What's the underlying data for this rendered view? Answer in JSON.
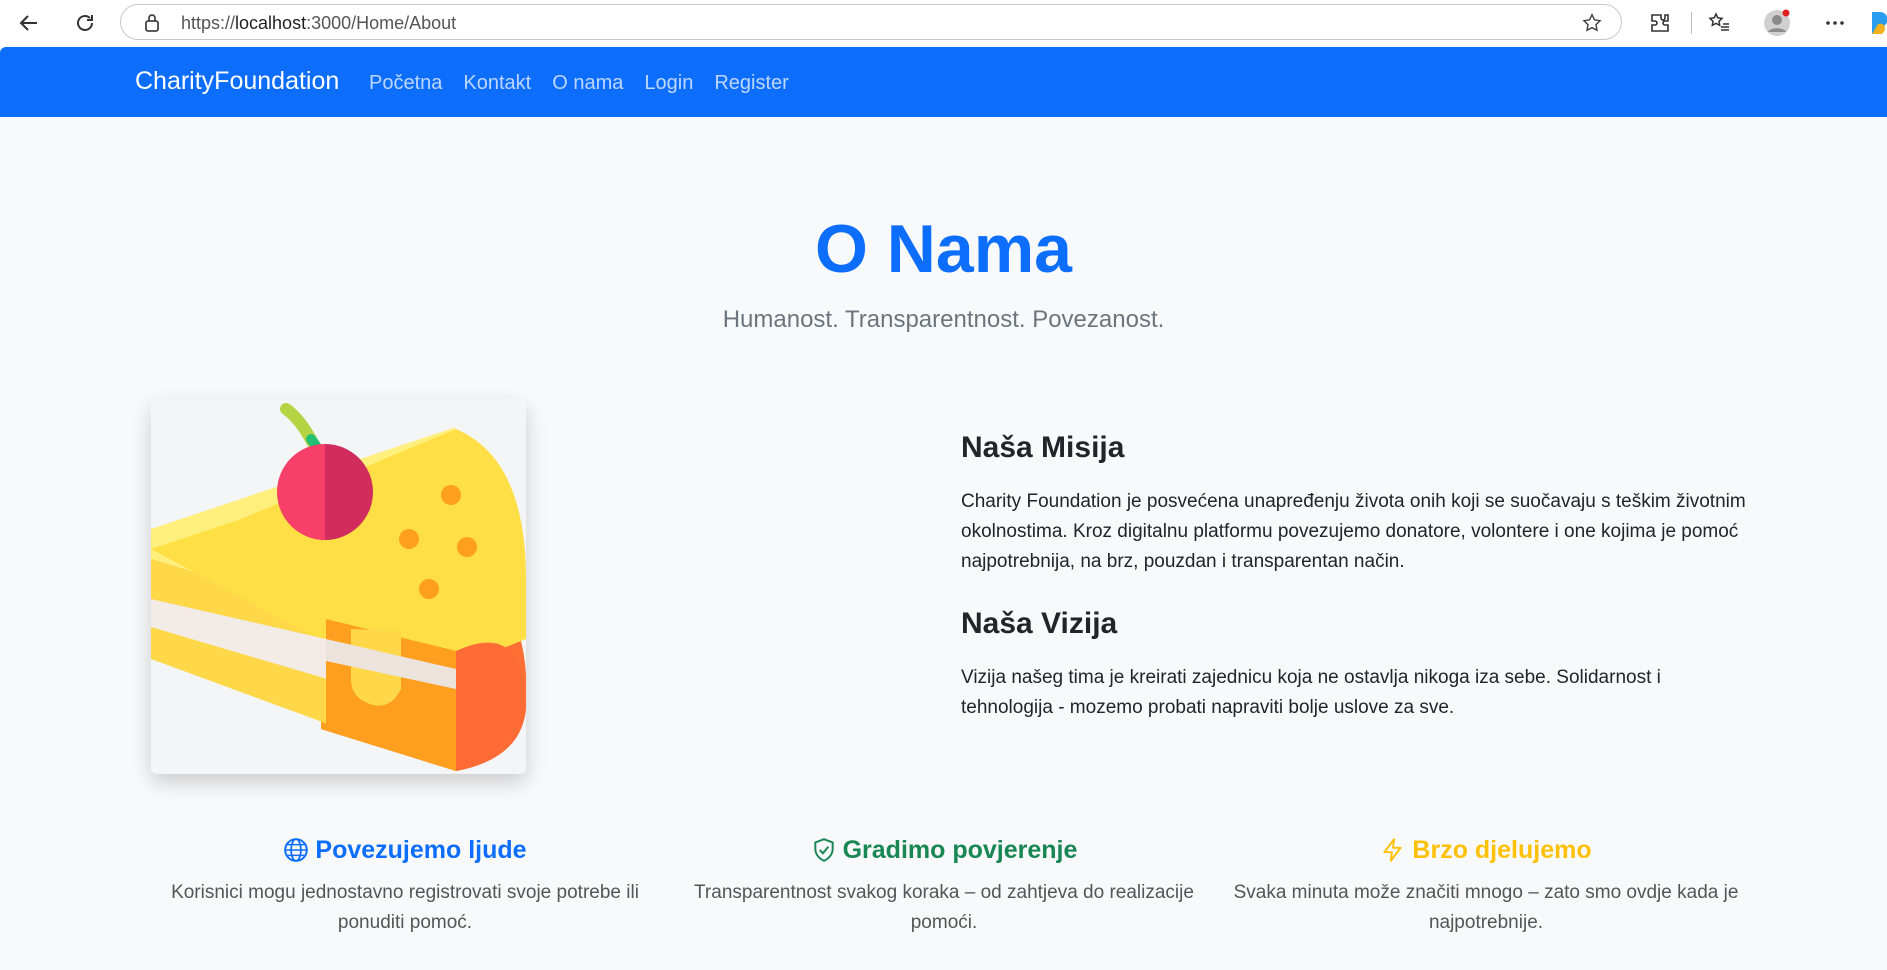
{
  "browser": {
    "url_prefix": "https://",
    "url_host": "localhost",
    "url_rest": ":3000/Home/About"
  },
  "navbar": {
    "brand": "CharityFoundation",
    "links": [
      "Početna",
      "Kontakt",
      "O nama",
      "Login",
      "Register"
    ]
  },
  "hero": {
    "title": "O Nama",
    "subtitle": "Humanost. Transparentnost. Povezanost."
  },
  "mission": {
    "heading": "Naša Misija",
    "text": "Charity Foundation je posvećena unapređenju života onih koji se suočavaju s teškim životnim okolnostima. Kroz digitalnu platformu povezujemo donatore, volontere i one kojima je pomoć najpotrebnija, na brz, pouzdan i transparentan način."
  },
  "vision": {
    "heading": "Naša Vizija",
    "text": "Vizija našeg tima je kreirati zajednicu koja ne ostavlja nikoga iza sebe. Solidarnost i tehnologija - mozemo probati napraviti bolje uslove za sve."
  },
  "features": [
    {
      "icon": "globe-icon",
      "title": "Povezujemo ljude",
      "text": "Korisnici mogu jednostavno registrovati svoje potrebe ili ponuditi pomoć.",
      "color": "#0d6efd"
    },
    {
      "icon": "shield-check-icon",
      "title": "Gradimo povjerenje",
      "text": "Transparentnost svakog koraka – od zahtjeva do realizacije pomoći.",
      "color": "#198754"
    },
    {
      "icon": "lightning-icon",
      "title": "Brzo djelujemo",
      "text": "Svaka minuta može značiti mnogo – zato smo ovdje kada je najpotrebnije.",
      "color": "#ffc107"
    }
  ],
  "colors": {
    "primary": "#0d6efd",
    "success": "#198754",
    "warning": "#ffc107"
  }
}
